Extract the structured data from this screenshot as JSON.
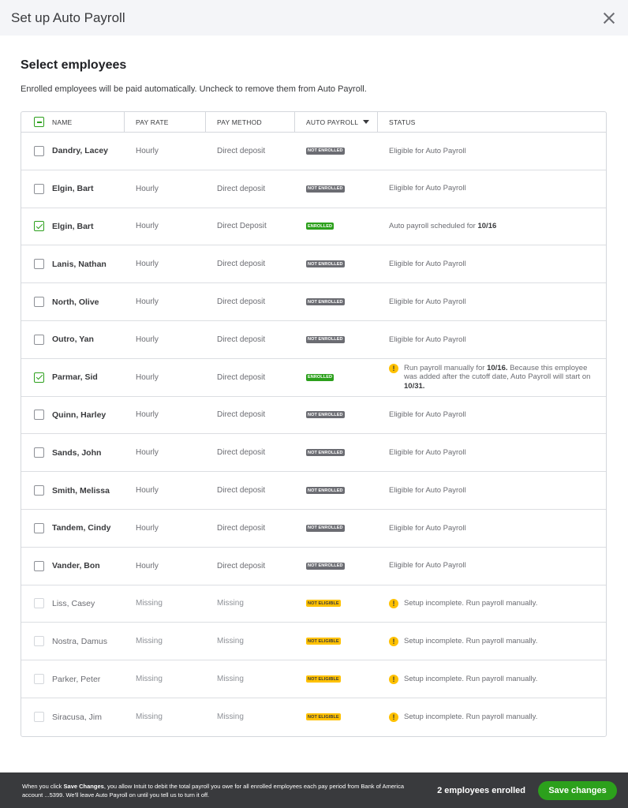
{
  "window": {
    "title": "Set up Auto Payroll"
  },
  "section": {
    "title": "Select employees",
    "subtitle": "Enrolled employees will be paid automatically. Uncheck to remove them from Auto Payroll."
  },
  "table": {
    "headers": {
      "name": "NAME",
      "pay_rate": "PAY RATE",
      "pay_method": "PAY METHOD",
      "auto_payroll": "AUTO PAYROLL",
      "status": "STATUS"
    },
    "rows": [
      {
        "name": "Dandry, Lacey",
        "rate": "Hourly",
        "method": "Direct deposit",
        "badge": "NOT ENROLLED",
        "badge_type": "not_enrolled",
        "checked": false,
        "disabled": false,
        "warn": false,
        "status": [
          "Eligible for Auto Payroll"
        ]
      },
      {
        "name": "Elgin, Bart",
        "rate": "Hourly",
        "method": "Direct deposit",
        "badge": "NOT ENROLLED",
        "badge_type": "not_enrolled",
        "checked": false,
        "disabled": false,
        "warn": false,
        "status": [
          "Eligible for Auto Payroll"
        ]
      },
      {
        "name": "Elgin, Bart",
        "rate": "Hourly",
        "method": "Direct Deposit",
        "badge": "ENROLLED",
        "badge_type": "enrolled",
        "checked": true,
        "disabled": false,
        "warn": false,
        "status": [
          "Auto payroll scheduled for ",
          {
            "b": "10/16"
          }
        ]
      },
      {
        "name": "Lanis, Nathan",
        "rate": "Hourly",
        "method": "Direct deposit",
        "badge": "NOT ENROLLED",
        "badge_type": "not_enrolled",
        "checked": false,
        "disabled": false,
        "warn": false,
        "status": [
          "Eligible for Auto Payroll"
        ]
      },
      {
        "name": "North, Olive",
        "rate": "Hourly",
        "method": "Direct deposit",
        "badge": "NOT ENROLLED",
        "badge_type": "not_enrolled",
        "checked": false,
        "disabled": false,
        "warn": false,
        "status": [
          "Eligible for Auto Payroll"
        ]
      },
      {
        "name": "Outro, Yan",
        "rate": "Hourly",
        "method": "Direct deposit",
        "badge": "NOT ENROLLED",
        "badge_type": "not_enrolled",
        "checked": false,
        "disabled": false,
        "warn": false,
        "status": [
          "Eligible for Auto Payroll"
        ]
      },
      {
        "name": "Parmar, Sid",
        "rate": "Hourly",
        "method": "Direct deposit",
        "badge": "ENROLLED",
        "badge_type": "enrolled",
        "checked": true,
        "disabled": false,
        "warn": true,
        "status": [
          "Run payroll manually for ",
          {
            "b": "10/16."
          },
          " Because this employee was added after the cutoff date, Auto Payroll will start on ",
          {
            "b": "10/31."
          }
        ]
      },
      {
        "name": "Quinn, Harley",
        "rate": "Hourly",
        "method": "Direct deposit",
        "badge": "NOT ENROLLED",
        "badge_type": "not_enrolled",
        "checked": false,
        "disabled": false,
        "warn": false,
        "status": [
          "Eligible for Auto Payroll"
        ]
      },
      {
        "name": "Sands, John",
        "rate": "Hourly",
        "method": "Direct deposit",
        "badge": "NOT ENROLLED",
        "badge_type": "not_enrolled",
        "checked": false,
        "disabled": false,
        "warn": false,
        "status": [
          "Eligible for Auto Payroll"
        ]
      },
      {
        "name": "Smith, Melissa",
        "rate": "Hourly",
        "method": "Direct deposit",
        "badge": "NOT ENROLLED",
        "badge_type": "not_enrolled",
        "checked": false,
        "disabled": false,
        "warn": false,
        "status": [
          "Eligible for Auto Payroll"
        ]
      },
      {
        "name": "Tandem, Cindy",
        "rate": "Hourly",
        "method": "Direct deposit",
        "badge": "NOT ENROLLED",
        "badge_type": "not_enrolled",
        "checked": false,
        "disabled": false,
        "warn": false,
        "status": [
          "Eligible for Auto Payroll"
        ]
      },
      {
        "name": "Vander, Bon",
        "rate": "Hourly",
        "method": "Direct deposit",
        "badge": "NOT ENROLLED",
        "badge_type": "not_enrolled",
        "checked": false,
        "disabled": false,
        "warn": false,
        "status": [
          "Eligible for Auto Payroll"
        ]
      },
      {
        "name": "Liss, Casey",
        "rate": "Missing",
        "method": "Missing",
        "badge": "NOT ELIGIBLE",
        "badge_type": "not_eligible",
        "checked": false,
        "disabled": true,
        "warn": true,
        "status": [
          "Setup incomplete. Run payroll manually."
        ]
      },
      {
        "name": "Nostra, Damus",
        "rate": "Missing",
        "method": "Missing",
        "badge": "NOT ELIGIBLE",
        "badge_type": "not_eligible",
        "checked": false,
        "disabled": true,
        "warn": true,
        "status": [
          "Setup incomplete. Run payroll manually."
        ]
      },
      {
        "name": "Parker, Peter",
        "rate": "Missing",
        "method": "Missing",
        "badge": "NOT ELIGIBLE",
        "badge_type": "not_eligible",
        "checked": false,
        "disabled": true,
        "warn": true,
        "status": [
          "Setup incomplete. Run payroll manually."
        ]
      },
      {
        "name": "Siracusa, Jim",
        "rate": "Missing",
        "method": "Missing",
        "badge": "NOT ELIGIBLE",
        "badge_type": "not_eligible",
        "checked": false,
        "disabled": true,
        "warn": true,
        "status": [
          "Setup incomplete. Run payroll manually."
        ]
      }
    ]
  },
  "footer": {
    "disclaimer_parts": [
      "When you click ",
      {
        "b": "Save Changes"
      },
      ", you allow Intuit to debit the total payroll you owe for all enrolled employees each pay period from Bank of America account ...5399.  We'll leave Auto Payroll on until you tell us to turn it off."
    ],
    "enrolled_count": "2 employees enrolled",
    "save_label": "Save changes"
  },
  "icons": {
    "close": "close-icon",
    "warning": "warning-icon",
    "sort": "caret-down-icon"
  },
  "colors": {
    "accent": "#2ca01c",
    "warning": "#ffc100",
    "footer_bg": "#393a3d",
    "not_enrolled": "#6b6c72"
  }
}
